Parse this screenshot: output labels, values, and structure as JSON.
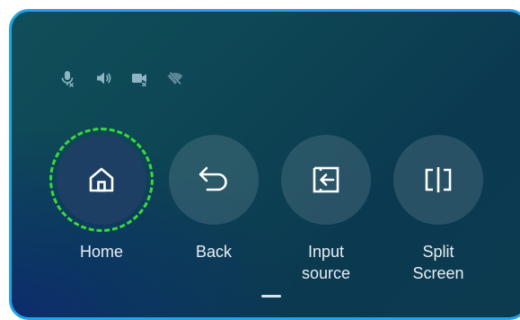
{
  "status_icons": [
    {
      "name": "mic-muted-icon"
    },
    {
      "name": "speaker-icon"
    },
    {
      "name": "camera-muted-icon"
    },
    {
      "name": "wifi-off-icon"
    }
  ],
  "buttons": [
    {
      "id": "home",
      "label": "Home",
      "icon": "home-icon",
      "focused": true
    },
    {
      "id": "back",
      "label": "Back",
      "icon": "back-arrow-icon",
      "focused": false
    },
    {
      "id": "input",
      "label_line1": "Input",
      "label_line2": "source",
      "icon": "input-source-icon",
      "focused": false
    },
    {
      "id": "split",
      "label_line1": "Split",
      "label_line2": "Screen",
      "icon": "split-screen-icon",
      "focused": false
    }
  ],
  "colors": {
    "panel_border": "#20a4ea",
    "focus_ring": "#3ad93a",
    "icon": "#ffffff",
    "status_icon": "#8fb5c4"
  }
}
